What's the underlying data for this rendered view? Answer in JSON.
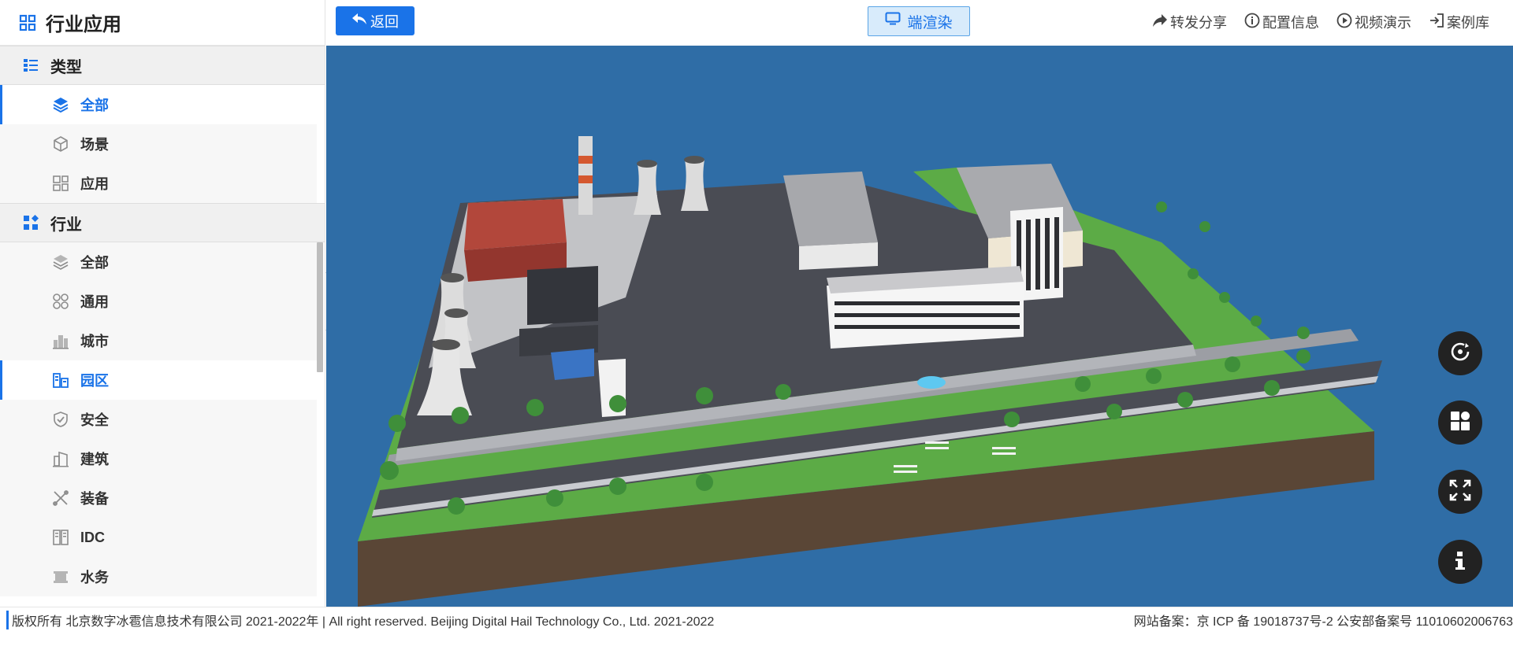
{
  "sidebar": {
    "title": "行业应用",
    "sections": [
      {
        "label": "类型",
        "items": [
          {
            "label": "全部",
            "icon": "layers-icon",
            "active": true
          },
          {
            "label": "场景",
            "icon": "cube-icon"
          },
          {
            "label": "应用",
            "icon": "grid-icon"
          }
        ]
      },
      {
        "label": "行业",
        "items": [
          {
            "label": "全部",
            "icon": "layers-icon"
          },
          {
            "label": "通用",
            "icon": "circles-icon"
          },
          {
            "label": "城市",
            "icon": "city-icon"
          },
          {
            "label": "园区",
            "icon": "park-icon",
            "active": true
          },
          {
            "label": "安全",
            "icon": "shield-icon"
          },
          {
            "label": "建筑",
            "icon": "building-icon"
          },
          {
            "label": "装备",
            "icon": "tools-icon"
          },
          {
            "label": "IDC",
            "icon": "server-icon"
          },
          {
            "label": "水务",
            "icon": "water-icon"
          }
        ]
      }
    ]
  },
  "topbar": {
    "back_label": "返回",
    "render_label": "端渲染",
    "actions": [
      {
        "label": "转发分享",
        "icon": "share-icon"
      },
      {
        "label": "配置信息",
        "icon": "info-circle-icon"
      },
      {
        "label": "视频演示",
        "icon": "play-circle-icon"
      },
      {
        "label": "案例库",
        "icon": "login-icon"
      }
    ]
  },
  "viewport": {
    "controls": [
      "rotate-icon",
      "layout-icon",
      "fullscreen-icon",
      "info-icon"
    ]
  },
  "footer": {
    "copyright": "版权所有 北京数字冰雹信息技术有限公司 2021-2022年 | All right reserved. Beijing Digital Hail Technology Co., Ltd. 2021-2022",
    "icp": "网站备案：京 ICP 备 19018737号-2 公安部备案号 11010602006763"
  },
  "colors": {
    "accent": "#1a73e8",
    "viewport_bg": "#2f6da6"
  }
}
